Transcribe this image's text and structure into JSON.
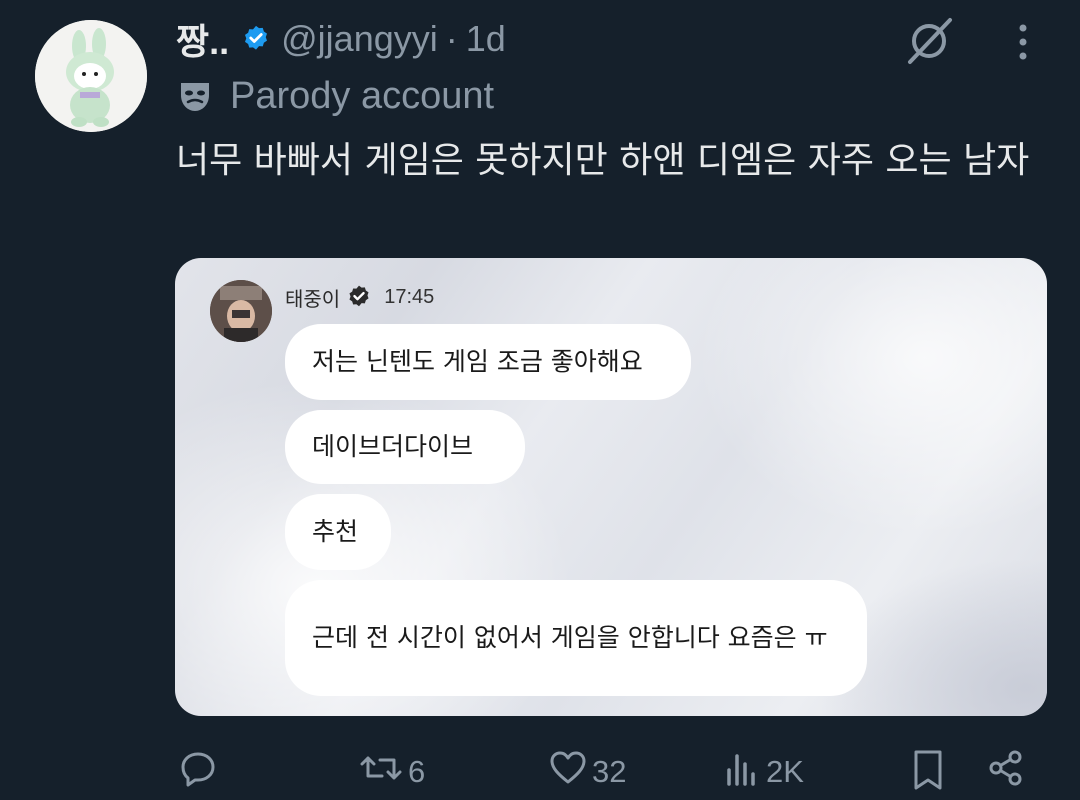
{
  "tweet": {
    "display_name": "짱..",
    "handle": "@jjangyyi",
    "separator": "·",
    "time": "1d",
    "label": "Parody account",
    "text": "너무 바빠서 게임은 못하지만 하앤 디엠은 자주 오는 남자"
  },
  "media": {
    "chat_name": "태중이",
    "chat_time": "17:45",
    "messages": [
      "저는 닌텐도 게임 조금 좋아해요",
      "데이브더다이브",
      "추천",
      "근데 전 시간이 없어서 게임을 안합니다 요즘은 ㅠ"
    ]
  },
  "actions": {
    "reposts": "6",
    "likes": "32",
    "views": "2K"
  },
  "colors": {
    "background": "#15202b",
    "verified": "#1d9bf0",
    "muted": "#8b98a5"
  },
  "icons": [
    "grok-icon",
    "more-icon",
    "parody-mask-icon",
    "verified-badge-icon",
    "reply-icon",
    "repost-icon",
    "like-icon",
    "views-icon",
    "bookmark-icon",
    "share-icon"
  ]
}
